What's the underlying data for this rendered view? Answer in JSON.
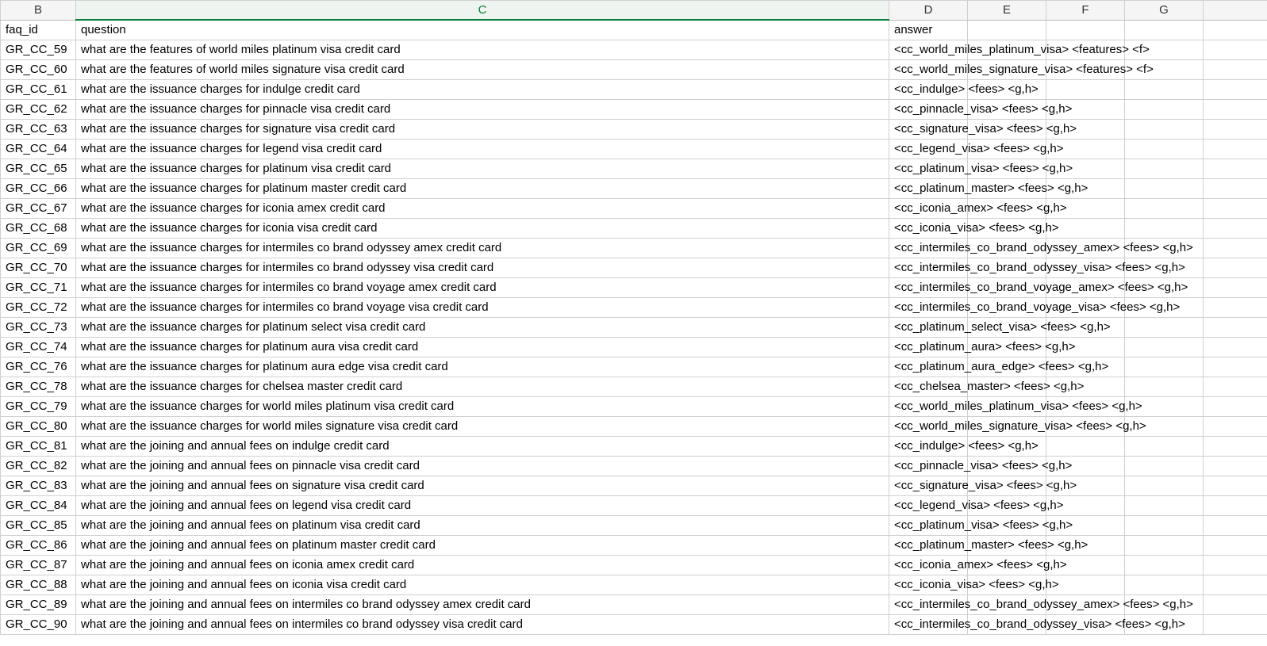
{
  "columns": {
    "B": "B",
    "C": "C",
    "D": "D",
    "E": "E",
    "F": "F",
    "G": "G"
  },
  "headers": {
    "B": "faq_id",
    "C": "question",
    "D": "answer"
  },
  "rows": [
    {
      "B": "GR_CC_59",
      "C": "what are the features of world miles platinum visa credit card",
      "D": "<cc_world_miles_platinum_visa> <features> <f>"
    },
    {
      "B": "GR_CC_60",
      "C": "what are the features of world miles signature visa credit card",
      "D": "<cc_world_miles_signature_visa> <features> <f>"
    },
    {
      "B": "GR_CC_61",
      "C": "what are the issuance charges for indulge credit card",
      "D": "<cc_indulge> <fees> <g,h>"
    },
    {
      "B": "GR_CC_62",
      "C": "what are the issuance charges for pinnacle visa credit card",
      "D": "<cc_pinnacle_visa> <fees> <g,h>"
    },
    {
      "B": "GR_CC_63",
      "C": "what are the issuance charges for signature visa credit card",
      "D": "<cc_signature_visa> <fees> <g,h>"
    },
    {
      "B": "GR_CC_64",
      "C": "what are the issuance charges for legend visa credit card",
      "D": "<cc_legend_visa> <fees> <g,h>"
    },
    {
      "B": "GR_CC_65",
      "C": "what are the issuance charges for platinum visa credit card",
      "D": "<cc_platinum_visa> <fees> <g,h>"
    },
    {
      "B": "GR_CC_66",
      "C": "what are the issuance charges for platinum master credit card",
      "D": "<cc_platinum_master> <fees> <g,h>"
    },
    {
      "B": "GR_CC_67",
      "C": "what are the issuance charges for iconia amex credit card",
      "D": "<cc_iconia_amex> <fees> <g,h>"
    },
    {
      "B": "GR_CC_68",
      "C": "what are the issuance charges for iconia visa credit card",
      "D": "<cc_iconia_visa> <fees> <g,h>"
    },
    {
      "B": "GR_CC_69",
      "C": "what are the issuance charges for intermiles co brand odyssey amex credit card",
      "D": "<cc_intermiles_co_brand_odyssey_amex> <fees> <g,h>"
    },
    {
      "B": "GR_CC_70",
      "C": "what are the issuance charges for intermiles co brand odyssey visa credit card",
      "D": "<cc_intermiles_co_brand_odyssey_visa> <fees> <g,h>"
    },
    {
      "B": "GR_CC_71",
      "C": "what are the issuance charges for intermiles co brand voyage amex credit card",
      "D": "<cc_intermiles_co_brand_voyage_amex> <fees> <g,h>"
    },
    {
      "B": "GR_CC_72",
      "C": "what are the issuance charges for intermiles co brand voyage visa credit card",
      "D": "<cc_intermiles_co_brand_voyage_visa> <fees> <g,h>"
    },
    {
      "B": "GR_CC_73",
      "C": "what are the issuance charges for platinum select visa credit card",
      "D": "<cc_platinum_select_visa> <fees> <g,h>"
    },
    {
      "B": "GR_CC_74",
      "C": "what are the issuance charges for platinum aura visa credit card",
      "D": "<cc_platinum_aura> <fees> <g,h>"
    },
    {
      "B": "GR_CC_76",
      "C": "what are the issuance charges for platinum aura edge visa credit card",
      "D": "<cc_platinum_aura_edge> <fees> <g,h>"
    },
    {
      "B": "GR_CC_78",
      "C": "what are the issuance charges for chelsea master credit card",
      "D": "<cc_chelsea_master> <fees> <g,h>"
    },
    {
      "B": "GR_CC_79",
      "C": "what are the issuance charges for world miles platinum visa credit card",
      "D": "<cc_world_miles_platinum_visa> <fees> <g,h>"
    },
    {
      "B": "GR_CC_80",
      "C": "what are the issuance charges for world miles signature visa credit card",
      "D": "<cc_world_miles_signature_visa> <fees> <g,h>"
    },
    {
      "B": "GR_CC_81",
      "C": "what are the joining and annual fees on indulge credit card",
      "D": "<cc_indulge> <fees> <g,h>"
    },
    {
      "B": "GR_CC_82",
      "C": "what are the joining and annual fees on pinnacle visa credit card",
      "D": "<cc_pinnacle_visa> <fees> <g,h>"
    },
    {
      "B": "GR_CC_83",
      "C": "what are the joining and annual fees on signature visa credit card",
      "D": "<cc_signature_visa> <fees> <g,h>"
    },
    {
      "B": "GR_CC_84",
      "C": "what are the joining and annual fees on legend visa credit card",
      "D": "<cc_legend_visa> <fees> <g,h>"
    },
    {
      "B": "GR_CC_85",
      "C": "what are the joining and annual fees on platinum visa credit card",
      "D": "<cc_platinum_visa> <fees> <g,h>"
    },
    {
      "B": "GR_CC_86",
      "C": "what are the joining and annual fees on platinum master credit card",
      "D": "<cc_platinum_master> <fees> <g,h>"
    },
    {
      "B": "GR_CC_87",
      "C": "what are the joining and annual fees on iconia amex credit card",
      "D": "<cc_iconia_amex> <fees> <g,h>"
    },
    {
      "B": "GR_CC_88",
      "C": "what are the joining and annual fees on iconia visa credit card",
      "D": "<cc_iconia_visa> <fees> <g,h>"
    },
    {
      "B": "GR_CC_89",
      "C": "what are the joining and annual fees on intermiles co brand odyssey amex credit card",
      "D": "<cc_intermiles_co_brand_odyssey_amex> <fees> <g,h>"
    },
    {
      "B": "GR_CC_90",
      "C": "what are the joining and annual fees on intermiles co brand odyssey visa credit card",
      "D": "<cc_intermiles_co_brand_odyssey_visa> <fees> <g,h>"
    }
  ]
}
